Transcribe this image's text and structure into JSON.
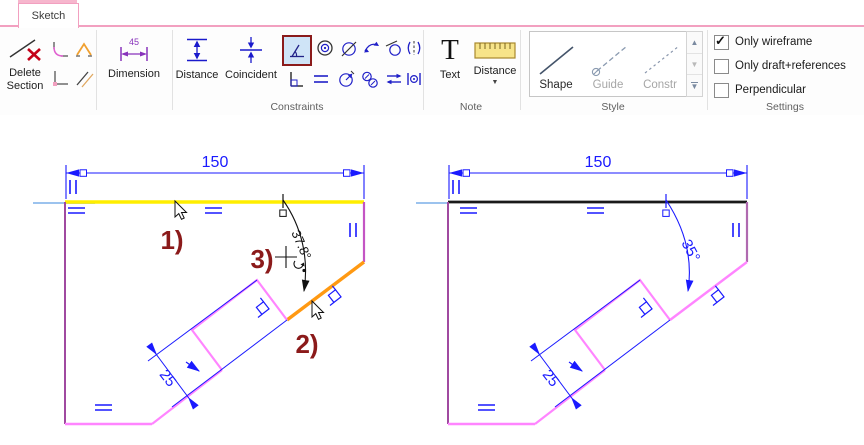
{
  "ribbon": {
    "tab": "Sketch",
    "delete_section": {
      "label": "Delete Section"
    },
    "dimension": {
      "label": "Dimension",
      "icon_value": "45"
    },
    "constraints": {
      "label": "Constraints",
      "distance": "Distance",
      "coincident": "Coincident",
      "icons": [
        "angle",
        "concentric",
        "diameter",
        "tangent",
        "touch",
        "split",
        "perpendicular",
        "equal",
        "radius",
        "equal-radius",
        "parallel",
        "symmetric"
      ],
      "selected_icon": "angle"
    },
    "note": {
      "label": "Note",
      "text_btn": "Text",
      "distance_btn": "Distance"
    },
    "style": {
      "label": "Style",
      "items": [
        "Shape",
        "Guide",
        "Constr"
      ]
    },
    "settings": {
      "label": "Settings",
      "options": [
        {
          "label": "Only wireframe",
          "checked": true
        },
        {
          "label": "Only draft+references",
          "checked": false
        },
        {
          "label": "Perpendicular",
          "checked": false
        }
      ]
    }
  },
  "canvas": {
    "left": {
      "width": "150",
      "slot": "25",
      "angle": "37.8°",
      "steps": [
        "1)",
        "2)",
        "3)"
      ]
    },
    "right": {
      "width": "150",
      "slot": "25",
      "angle": "35°"
    }
  },
  "colors": {
    "selection_yellow": "#ffee00",
    "selection_orange": "#ff9912",
    "sketch_pink": "#ff85ff",
    "sketch_purple": "#ae4fae",
    "dimension_blue": "#1a1aff",
    "construction_blue": "#9cc3ee",
    "highlight_border": "#8b1b1b",
    "highlight_fill": "#cfe4f7",
    "step_label_red": "#8b1a1a",
    "tab_pink": "#f2a0c0"
  }
}
